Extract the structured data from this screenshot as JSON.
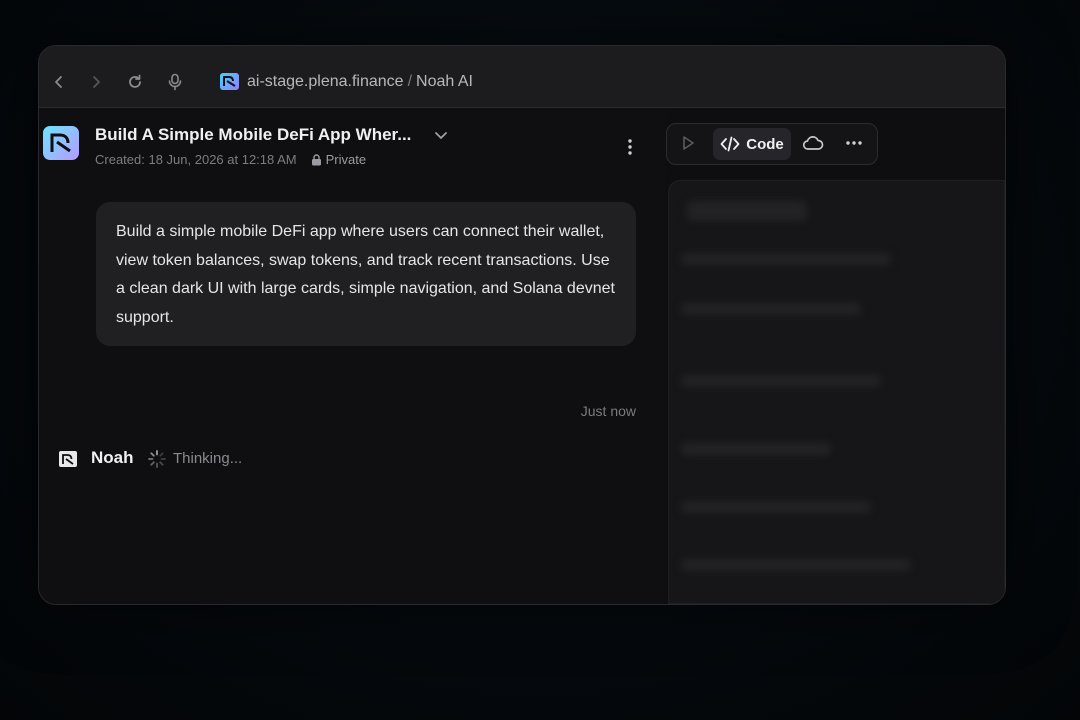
{
  "browser": {
    "url_domain": "ai-stage.plena.finance",
    "url_separator": "/",
    "url_page": "Noah AI"
  },
  "chat": {
    "title": "Build A Simple Mobile DeFi App Wher...",
    "created": "Created: 18 Jun, 2026 at 12:18 AM",
    "visibility": "Private"
  },
  "messages": [
    {
      "role": "user",
      "text": "Build a simple mobile DeFi app where users can connect their wallet, view token balances, swap tokens, and track recent transactions. Use a clean dark UI with large cards, simple navigation, and Solana devnet support.",
      "time": "Just now"
    }
  ],
  "agent": {
    "name": "Noah",
    "status": "Thinking..."
  },
  "toolbar": {
    "code_label": "Code"
  },
  "icons": {
    "back": "chevron-left-icon",
    "forward": "chevron-right-icon",
    "reload": "reload-icon",
    "mic": "mic-icon",
    "lock": "lock-icon",
    "more": "more-vertical-icon",
    "play": "play-icon",
    "code": "code-icon",
    "cloud": "cloud-icon",
    "ellipsis": "more-horizontal-icon",
    "spinner": "spinner-icon"
  },
  "colors": {
    "accent_gradient_start": "#3dd6ff",
    "accent_gradient_end": "#9a7cff",
    "background": "#0f0f11"
  }
}
